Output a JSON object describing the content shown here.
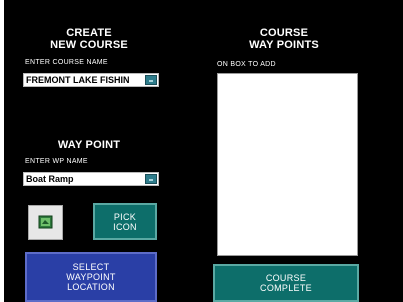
{
  "create": {
    "heading_line1": "CREATE",
    "heading_line2": "NEW COURSE",
    "name_label": "ENTER COURSE NAME",
    "name_value": "FREMONT LAKE FISHIN"
  },
  "waypoint": {
    "heading": "WAY POINT",
    "name_label": "ENTER WP NAME",
    "name_value": "Boat Ramp",
    "pick_icon_line1": "PICK",
    "pick_icon_line2": "ICON",
    "select_line1": "SELECT",
    "select_line2": "WAYPOINT",
    "select_line3": "LOCATION"
  },
  "course_points": {
    "heading_line1": "COURSE",
    "heading_line2": "WAY POINTS",
    "hint": "ON BOX TO ADD",
    "items": []
  },
  "course_complete": {
    "line1": "COURSE",
    "line2": "COMPLETE"
  },
  "colors": {
    "background": "#000000",
    "teal_button": "#0d6e6a",
    "blue_button": "#2a3fa6",
    "dropdown": "#2e7d8c"
  },
  "icons": {
    "selected_icon": "boat-ramp-icon",
    "dropdown": "chevron-down-icon"
  }
}
